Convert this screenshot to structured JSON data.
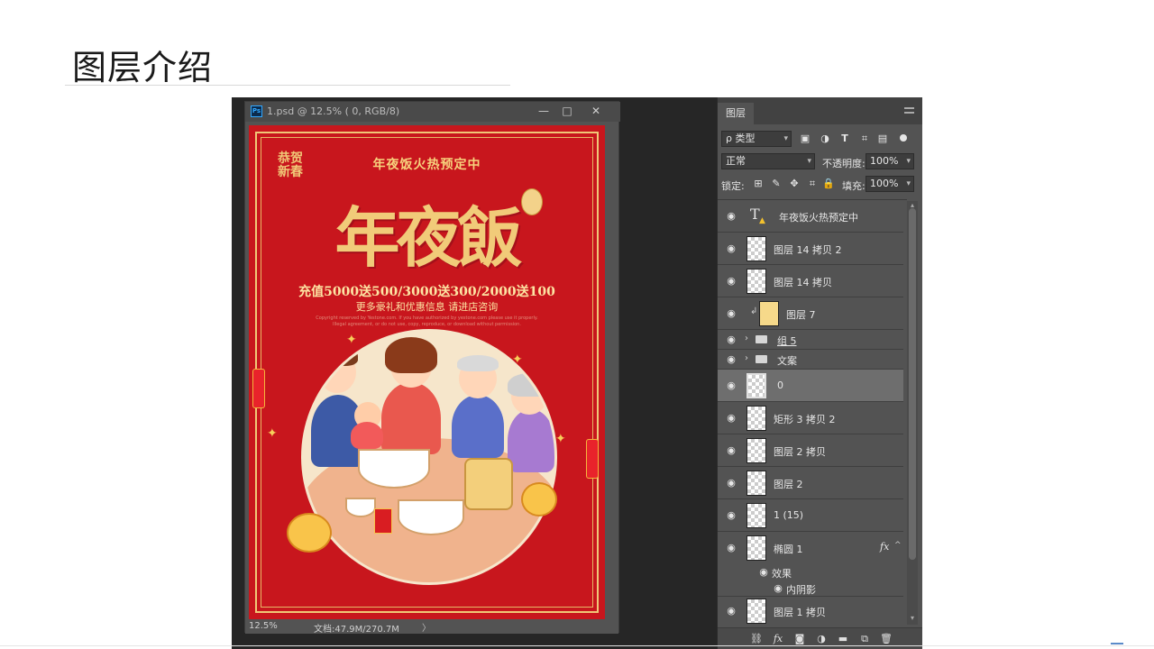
{
  "slide": {
    "title": "图层介绍"
  },
  "document": {
    "window_title": "1.psd @ 12.5% ( 0, RGB/8)",
    "app_badge": "Ps",
    "minimize_icon": "—",
    "maximize_icon": "□",
    "close_icon": "✕",
    "zoom": "12.5%",
    "doc_info": "文档:47.9M/270.7M",
    "status_arrow": "〉"
  },
  "poster": {
    "tagline": "年夜饭火热预定中",
    "title": "年夜飯",
    "side_text": "恭贺新春",
    "promo": "充值5000送500/3000送300/2000送100",
    "promo_sub": "更多豪礼和优惠信息 请进店咨询",
    "fine_print_1": "Copyright reserved by Yestone.com. If you have authorized by yestone.com please use it properly.",
    "fine_print_2": "Illegal agreement, or do not use, copy, reproduce, or download without permission."
  },
  "layers_panel": {
    "tab_label": "图层",
    "filter_label": "ρ 类型",
    "blend_mode": "正常",
    "opacity_label": "不透明度:",
    "opacity_value": "100%",
    "lock_label": "锁定:",
    "fill_label": "填充:",
    "fill_value": "100%",
    "layers": [
      {
        "name": "年夜饭火热预定中",
        "kind": "text",
        "selected": false
      },
      {
        "name": "图层 14 拷贝 2",
        "kind": "pixel",
        "selected": false
      },
      {
        "name": "图层 14 拷贝",
        "kind": "pixel",
        "selected": false
      },
      {
        "name": "图层 7",
        "kind": "pixel-clipped",
        "selected": false
      },
      {
        "name": "组 5",
        "kind": "group",
        "selected": false
      },
      {
        "name": "文案",
        "kind": "group",
        "selected": false
      },
      {
        "name": "0",
        "kind": "pixel",
        "selected": true
      },
      {
        "name": "矩形 3 拷贝 2",
        "kind": "pixel",
        "selected": false
      },
      {
        "name": "图层 2 拷贝",
        "kind": "pixel",
        "selected": false
      },
      {
        "name": "图层 2",
        "kind": "pixel",
        "selected": false
      },
      {
        "name": "1 (15)",
        "kind": "pixel",
        "selected": false
      },
      {
        "name": "椭圆 1",
        "kind": "shape",
        "selected": false
      }
    ],
    "effects_label": "效果",
    "effect_item": "内阴影",
    "last_layer": "图层 1 拷贝",
    "fx_badge": "fx",
    "fx_caret": "^",
    "eye_glyph": "👁",
    "bottom_icons": [
      "link-icon",
      "fx-icon",
      "mask-icon",
      "adjustment-icon",
      "folder-icon",
      "new-layer-icon",
      "trash-icon"
    ]
  }
}
